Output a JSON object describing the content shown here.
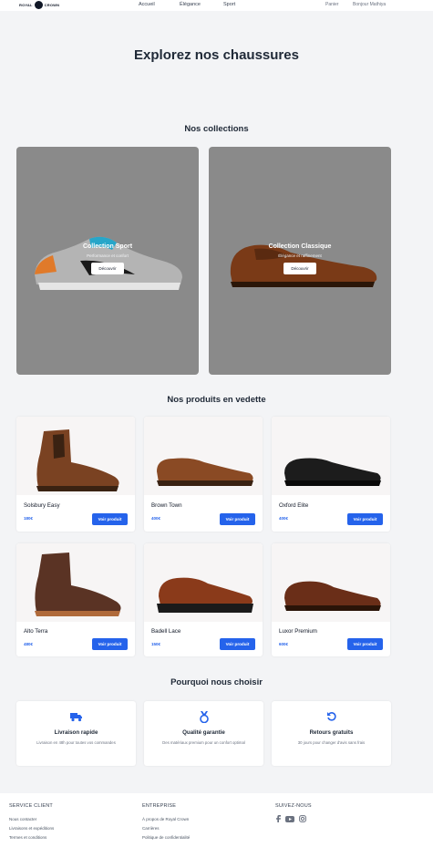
{
  "navbar": {
    "logo_text_left": "ROYAL",
    "logo_text_right": "CROWN",
    "links": [
      "Accueil",
      "Élégance",
      "Sport"
    ],
    "panier": "Panier",
    "greeting": "Bonjour Mathiya"
  },
  "hero": {
    "title": "Explorez nos chaussures"
  },
  "collections": {
    "title": "Nos collections",
    "items": [
      {
        "name": "Collection Sport",
        "subtitle": "Performance et confort",
        "button": "Découvrir"
      },
      {
        "name": "Collection Classique",
        "subtitle": "Élégance et raffinement",
        "button": "Découvrir"
      }
    ]
  },
  "products": {
    "title": "Nos produits en vedette",
    "button_label": "Voir produit",
    "items": [
      {
        "name": "Solsbury Easy",
        "price": "180€"
      },
      {
        "name": "Brown Town",
        "price": "400€"
      },
      {
        "name": "Oxford Elite",
        "price": "400€"
      },
      {
        "name": "Alto Terra",
        "price": "480€"
      },
      {
        "name": "Badell Lace",
        "price": "150€"
      },
      {
        "name": "Luxor Premium",
        "price": "600€"
      }
    ]
  },
  "features": {
    "title": "Pourquoi nous choisir",
    "items": [
      {
        "title": "Livraison rapide",
        "desc": "Livraison en 48h pour toutes vos commandes",
        "icon": "truck-icon"
      },
      {
        "title": "Qualité garantie",
        "desc": "Des matériaux premium pour un confort optimal",
        "icon": "medal-icon"
      },
      {
        "title": "Retours gratuits",
        "desc": "30 jours pour changer d'avis sans frais",
        "icon": "return-icon"
      }
    ]
  },
  "footer": {
    "service": {
      "title": "SERVICE CLIENT",
      "links": [
        "Nous contacter",
        "Livraisons et expéditions",
        "Termes et conditions"
      ]
    },
    "entreprise": {
      "title": "ENTREPRISE",
      "links": [
        "À propos de Royal Crown",
        "Carrières",
        "Politique de confidentialité"
      ]
    },
    "social": {
      "title": "SUIVEZ-NOUS",
      "icons": [
        "facebook-icon",
        "youtube-icon",
        "instagram-icon"
      ]
    }
  },
  "colors": {
    "accent": "#2563eb",
    "background": "#f3f4f6",
    "card_overlay": "#8a8a8a"
  }
}
